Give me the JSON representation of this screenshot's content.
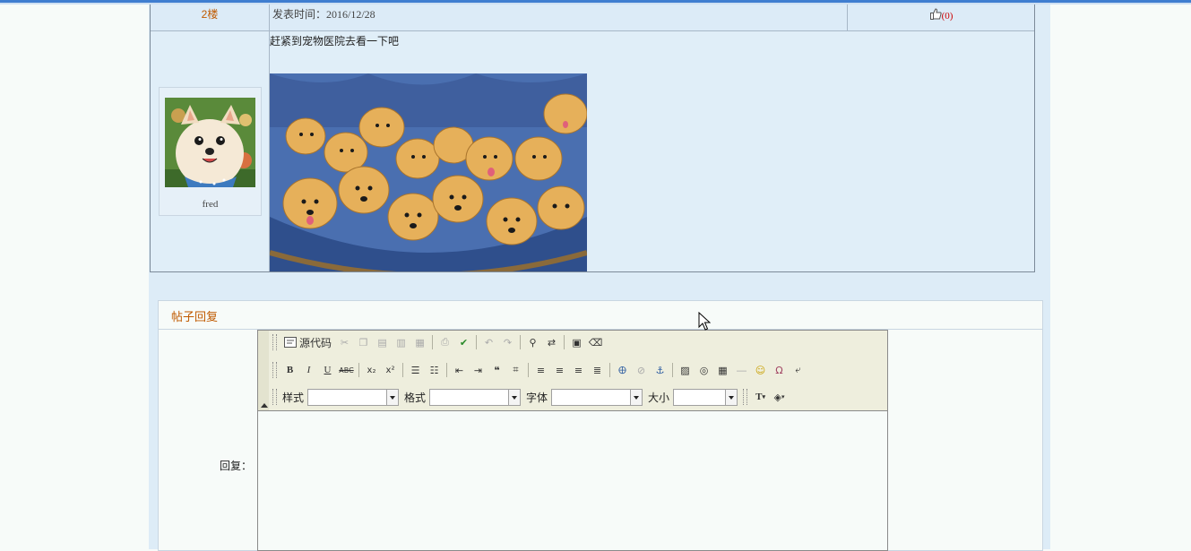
{
  "post": {
    "floor": "2楼",
    "time_label": "发表时间：2016/12/28",
    "like_count": "(0)",
    "author": "fred",
    "content": "赶紧到宠物医院去看一下吧"
  },
  "reply": {
    "section_title": "帖子回复",
    "label": "回复："
  },
  "editor": {
    "source_label": "源代码",
    "style_label": "样式",
    "format_label": "格式",
    "font_label": "字体",
    "size_label": "大小",
    "style_value": "",
    "format_value": "",
    "font_value": "",
    "size_value": ""
  },
  "toolbar_row1_icons": [
    "cut-icon",
    "copy-icon",
    "paste-icon",
    "paste-text-icon",
    "paste-word-icon",
    "print-icon",
    "spellcheck-icon",
    "undo-icon",
    "redo-icon",
    "find-icon",
    "replace-icon",
    "select-all-icon",
    "remove-format-icon"
  ],
  "toolbar_row2_icons": [
    "bold-icon",
    "italic-icon",
    "underline-icon",
    "strike-icon",
    "subscript-icon",
    "superscript-icon",
    "ordered-list-icon",
    "unordered-list-icon",
    "outdent-icon",
    "indent-icon",
    "blockquote-icon",
    "div-icon",
    "align-left-icon",
    "align-center-icon",
    "align-right-icon",
    "align-justify-icon",
    "link-icon",
    "unlink-icon",
    "anchor-icon",
    "image-icon",
    "flash-icon",
    "table-icon",
    "horizontal-rule-icon",
    "smiley-icon",
    "special-char-icon",
    "page-break-icon"
  ],
  "colors": {
    "accent": "#c05a00",
    "like": "#cc0000",
    "topbar": "#3f7ed0",
    "page_bg": "#ddecf7"
  }
}
